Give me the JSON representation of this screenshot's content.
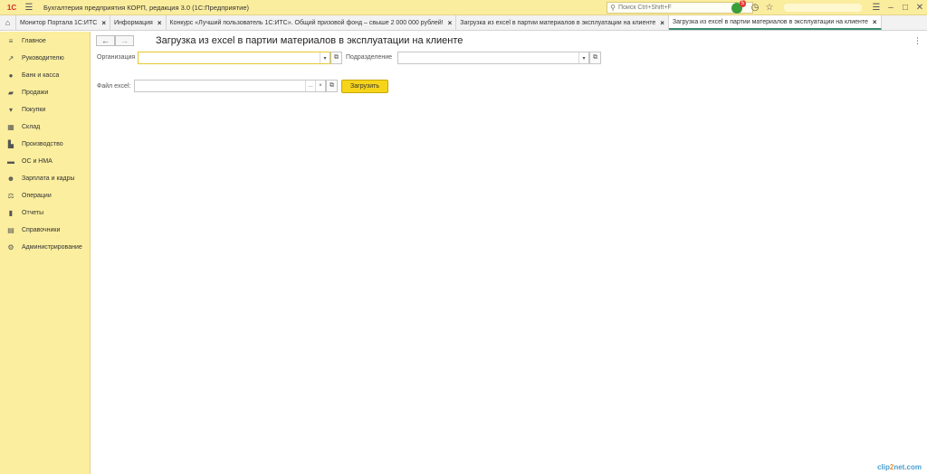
{
  "titlebar": {
    "logo": "1С",
    "app_title": "Бухгалтерия предприятия КОРП, редакция 3.0  (1С:Предприятие)",
    "search_placeholder": "Поиск Ctrl+Shift+F",
    "notification_count": "5"
  },
  "tabs": [
    {
      "label": "Монитор Портала 1С:ИТС"
    },
    {
      "label": "Информация"
    },
    {
      "label": "Конкурс «Лучший пользователь 1С:ИТС». Общий призовой фонд – свыше 2 000 000 рублей!"
    },
    {
      "label": "Загрузка из excel в партии материалов в эксплуатации на клиенте"
    },
    {
      "label": "Загрузка из excel в партии материалов в эксплуатации на клиенте",
      "active": true
    }
  ],
  "sidebar": {
    "items": [
      {
        "label": "Главное",
        "icon": "menu-icon"
      },
      {
        "label": "Руководителю",
        "icon": "trend-icon"
      },
      {
        "label": "Банк и касса",
        "icon": "coins-icon"
      },
      {
        "label": "Продажи",
        "icon": "bag-icon"
      },
      {
        "label": "Покупки",
        "icon": "cart-icon"
      },
      {
        "label": "Склад",
        "icon": "warehouse-icon"
      },
      {
        "label": "Производство",
        "icon": "factory-icon"
      },
      {
        "label": "ОС и НМА",
        "icon": "assets-icon"
      },
      {
        "label": "Зарплата и кадры",
        "icon": "people-icon"
      },
      {
        "label": "Операции",
        "icon": "operations-icon"
      },
      {
        "label": "Отчеты",
        "icon": "chart-icon"
      },
      {
        "label": "Справочники",
        "icon": "book-icon"
      },
      {
        "label": "Администрирование",
        "icon": "gear-icon"
      }
    ]
  },
  "form": {
    "title": "Загрузка из excel в партии материалов в эксплуатации на клиенте",
    "org_label": "Организация",
    "org_value": "",
    "dept_label": "Подразделение",
    "dept_value": "",
    "file_label": "Файл excel:",
    "file_value": "",
    "load_button": "Загрузить"
  },
  "watermark": {
    "a": "clip",
    "b": "2",
    "c": "net.com"
  },
  "colors": {
    "sidebar_bg": "#fbee9e",
    "accent_button": "#f6d41a",
    "active_tab_line": "#3b8c6e"
  }
}
